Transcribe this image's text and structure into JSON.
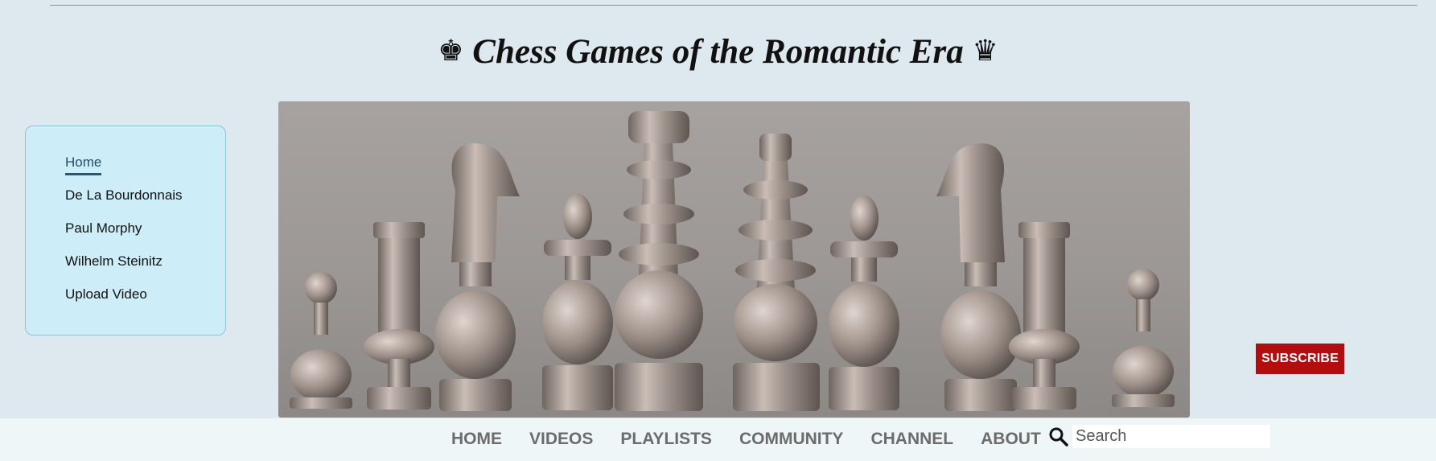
{
  "header": {
    "title": "Chess Games of the Romantic Era",
    "left_glyph": "♚",
    "right_glyph": "♛"
  },
  "sidebar": {
    "items": [
      {
        "label": "Home",
        "active": true
      },
      {
        "label": "De La Bourdonnais"
      },
      {
        "label": "Paul Morphy"
      },
      {
        "label": "Wilhelm Steinitz"
      },
      {
        "label": "Upload Video"
      }
    ]
  },
  "hero": {
    "image": "antique silver chess pieces lined up",
    "pieces": [
      "pawn",
      "rook",
      "knight",
      "bishop",
      "king",
      "queen",
      "bishop",
      "knight",
      "rook",
      "pawn"
    ]
  },
  "subscribe": {
    "label": "SUBSCRIBE",
    "color": "#b30d0d"
  },
  "nav": {
    "links": [
      "HOME",
      "VIDEOS",
      "PLAYLISTS",
      "COMMUNITY",
      "CHANNEL",
      "ABOUT"
    ],
    "search_placeholder": "Search",
    "search_icon": "search-icon"
  },
  "colors": {
    "background": "#dde9ef",
    "sidebar_bg": "#cdedf8",
    "nav_bg": "#eef6f8",
    "nav_text": "#6c6c6c"
  }
}
